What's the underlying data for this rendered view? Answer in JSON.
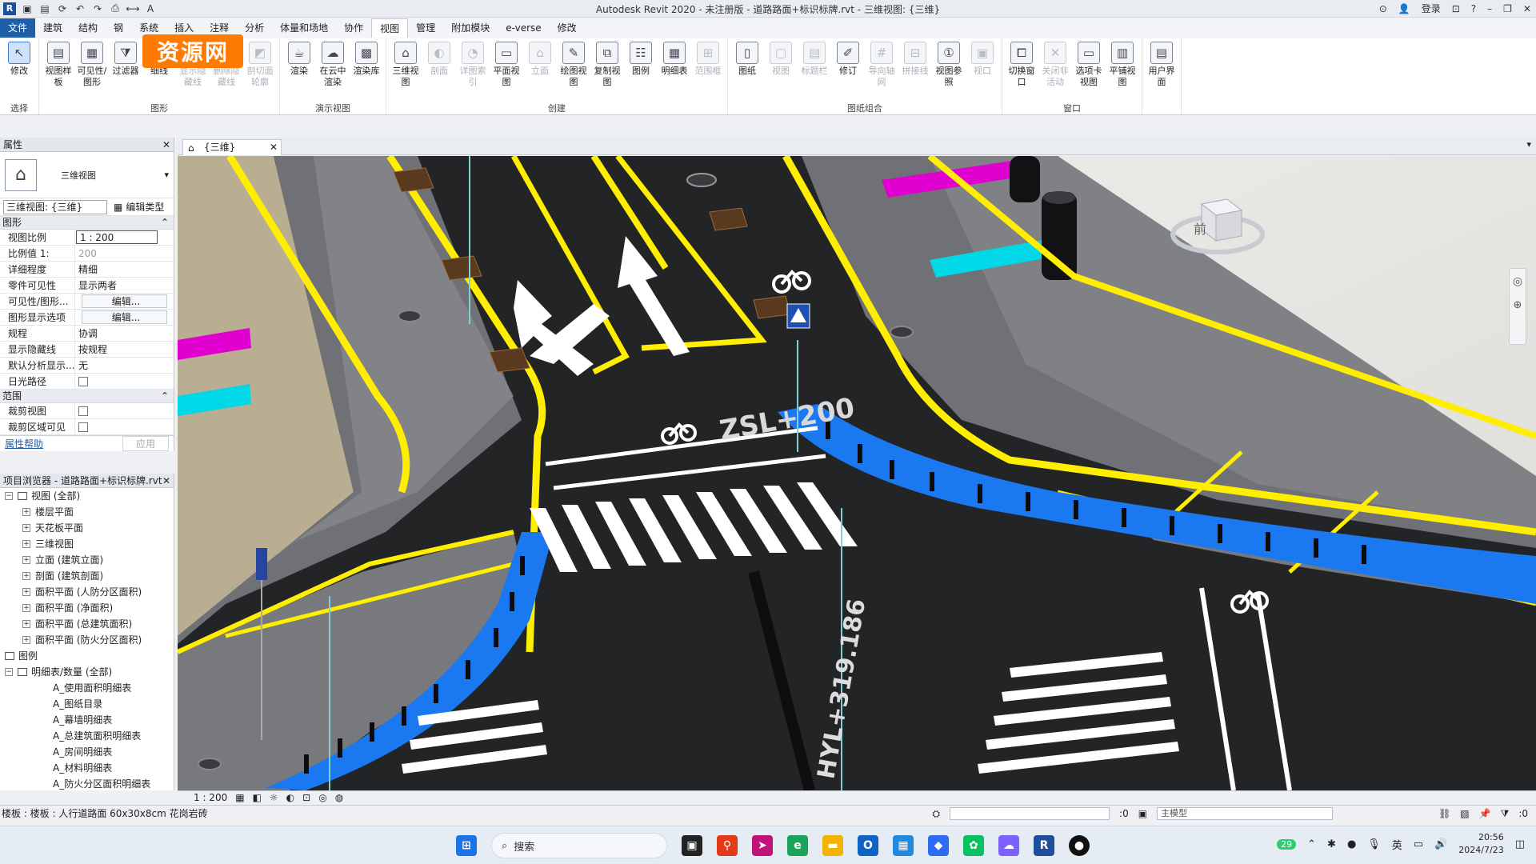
{
  "window": {
    "title": "Autodesk Revit 2020 - 未注册版 - 道路路面+标识标牌.rvt - 三维视图: {三维}",
    "login": "登录"
  },
  "watermark": "资源网",
  "menu": {
    "tabs": [
      "文件",
      "建筑",
      "结构",
      "钢",
      "系统",
      "插入",
      "注释",
      "分析",
      "体量和场地",
      "协作",
      "视图",
      "管理",
      "附加模块",
      "e-verse",
      "修改"
    ]
  },
  "ribbon": {
    "groups": [
      {
        "name": "选择",
        "tools": [
          {
            "label": "修改",
            "icon": "↖",
            "sel": true
          }
        ]
      },
      {
        "name": "图形",
        "tools": [
          {
            "label": "视图样板",
            "icon": "▤"
          },
          {
            "label": "可见性/图形",
            "icon": "▦"
          },
          {
            "label": "过滤器",
            "icon": "⧩"
          },
          {
            "label": "细线",
            "icon": "≡"
          },
          {
            "label": "显示隐藏线",
            "icon": "◫",
            "dim": true
          },
          {
            "label": "删除隐藏线",
            "icon": "◪",
            "dim": true
          },
          {
            "label": "剖切面轮廓",
            "icon": "◩",
            "dim": true
          }
        ]
      },
      {
        "name": "演示视图",
        "tools": [
          {
            "label": "渲染",
            "icon": "☕"
          },
          {
            "label": "在云中渲染",
            "icon": "☁"
          },
          {
            "label": "渲染库",
            "icon": "▩"
          }
        ]
      },
      {
        "name": "创建",
        "tools": [
          {
            "label": "三维视图",
            "icon": "⌂"
          },
          {
            "label": "剖面",
            "icon": "◐",
            "dim": true
          },
          {
            "label": "详图索引",
            "icon": "◔",
            "dim": true
          },
          {
            "label": "平面视图",
            "icon": "▭"
          },
          {
            "label": "立面",
            "icon": "⌂",
            "dim": true
          },
          {
            "label": "绘图视图",
            "icon": "✎"
          },
          {
            "label": "复制视图",
            "icon": "⧉"
          },
          {
            "label": "图例",
            "icon": "☷"
          },
          {
            "label": "明细表",
            "icon": "▦"
          },
          {
            "label": "范围框",
            "icon": "⊞",
            "dim": true
          }
        ]
      },
      {
        "name": "图纸组合",
        "tools": [
          {
            "label": "图纸",
            "icon": "▯"
          },
          {
            "label": "视图",
            "icon": "▢",
            "dim": true
          },
          {
            "label": "标题栏",
            "icon": "▤",
            "dim": true
          },
          {
            "label": "修订",
            "icon": "✐"
          },
          {
            "label": "导向轴网",
            "icon": "#",
            "dim": true
          },
          {
            "label": "拼接线",
            "icon": "⊟",
            "dim": true
          },
          {
            "label": "视图参照",
            "icon": "①"
          },
          {
            "label": "视口",
            "icon": "▣",
            "dim": true
          }
        ]
      },
      {
        "name": "窗口",
        "tools": [
          {
            "label": "切换窗口",
            "icon": "⧠"
          },
          {
            "label": "关闭非活动",
            "icon": "✕",
            "dim": true
          },
          {
            "label": "选项卡视图",
            "icon": "▭"
          },
          {
            "label": "平铺视图",
            "icon": "▥"
          }
        ]
      },
      {
        "name": "",
        "tools": [
          {
            "label": "用户界面",
            "icon": "▤"
          }
        ]
      }
    ]
  },
  "properties": {
    "title": "属性",
    "type_name": "三维视图",
    "selector": "三维视图: {三维}",
    "edit_type": "编辑类型",
    "sections": {
      "graphics": "图形",
      "extents": "范围"
    },
    "rows": [
      {
        "k": "视图比例",
        "v": "1 : 200",
        "style": "box"
      },
      {
        "k": "比例值 1:",
        "v": "200",
        "style": "gray"
      },
      {
        "k": "详细程度",
        "v": "精细"
      },
      {
        "k": "零件可见性",
        "v": "显示两者"
      },
      {
        "k": "可见性/图形...",
        "v": "编辑...",
        "style": "btn"
      },
      {
        "k": "图形显示选项",
        "v": "编辑...",
        "style": "btn"
      },
      {
        "k": "规程",
        "v": "协调"
      },
      {
        "k": "显示隐藏线",
        "v": "按规程"
      },
      {
        "k": "默认分析显示...",
        "v": "无"
      },
      {
        "k": "日光路径",
        "v": "",
        "style": "chk"
      }
    ],
    "extent_rows": [
      {
        "k": "裁剪视图",
        "v": "",
        "style": "chk"
      },
      {
        "k": "裁剪区域可见",
        "v": "",
        "style": "chk"
      }
    ],
    "help": "属性帮助",
    "apply": "应用"
  },
  "browser": {
    "title": "项目浏览器 - 道路路面+标识标牌.rvt",
    "items": [
      {
        "t": "视图 (全部)",
        "lv": 0,
        "tg": "−",
        "ico": true
      },
      {
        "t": "楼层平面",
        "lv": 1,
        "tg": "+"
      },
      {
        "t": "天花板平面",
        "lv": 1,
        "tg": "+"
      },
      {
        "t": "三维视图",
        "lv": 1,
        "tg": "+"
      },
      {
        "t": "立面 (建筑立面)",
        "lv": 1,
        "tg": "+"
      },
      {
        "t": "剖面 (建筑剖面)",
        "lv": 1,
        "tg": "+"
      },
      {
        "t": "面积平面 (人防分区面积)",
        "lv": 1,
        "tg": "+"
      },
      {
        "t": "面积平面 (净面积)",
        "lv": 1,
        "tg": "+"
      },
      {
        "t": "面积平面 (总建筑面积)",
        "lv": 1,
        "tg": "+"
      },
      {
        "t": "面积平面 (防火分区面积)",
        "lv": 1,
        "tg": "+"
      },
      {
        "t": "图例",
        "lv": 0,
        "tg": "",
        "ico": true
      },
      {
        "t": "明细表/数量 (全部)",
        "lv": 0,
        "tg": "−",
        "ico": true
      },
      {
        "t": "A_使用面积明细表",
        "lv": 2,
        "tg": ""
      },
      {
        "t": "A_图纸目录",
        "lv": 2,
        "tg": ""
      },
      {
        "t": "A_幕墙明细表",
        "lv": 2,
        "tg": ""
      },
      {
        "t": "A_总建筑面积明细表",
        "lv": 2,
        "tg": ""
      },
      {
        "t": "A_房间明细表",
        "lv": 2,
        "tg": ""
      },
      {
        "t": "A_材料明细表",
        "lv": 2,
        "tg": ""
      },
      {
        "t": "A_防火分区面积明细表",
        "lv": 2,
        "tg": ""
      }
    ]
  },
  "view_tab": {
    "label": "{三维}"
  },
  "viewport": {
    "road_text_1": "ZSL+200",
    "road_text_2": "HYL+319.186",
    "navcube_face": "前",
    "colors": {
      "asphalt": "#232426",
      "yellow": "#ffee00",
      "blue": "#1a78f0",
      "curb": "#7d7f84",
      "magenta": "#e000d0",
      "cyan": "#00d8e8"
    }
  },
  "viewbar": {
    "scale": "1 : 200"
  },
  "status": {
    "text": "楼板 : 楼板 : 人行道路面 60x30x8cm 花岗岩砖",
    "model": "主模型",
    "count": ":0",
    "filter": ":0"
  },
  "taskbar": {
    "search": "搜索",
    "time": "20:56",
    "date": "2024/7/23",
    "ime": "英",
    "badge": "29"
  }
}
